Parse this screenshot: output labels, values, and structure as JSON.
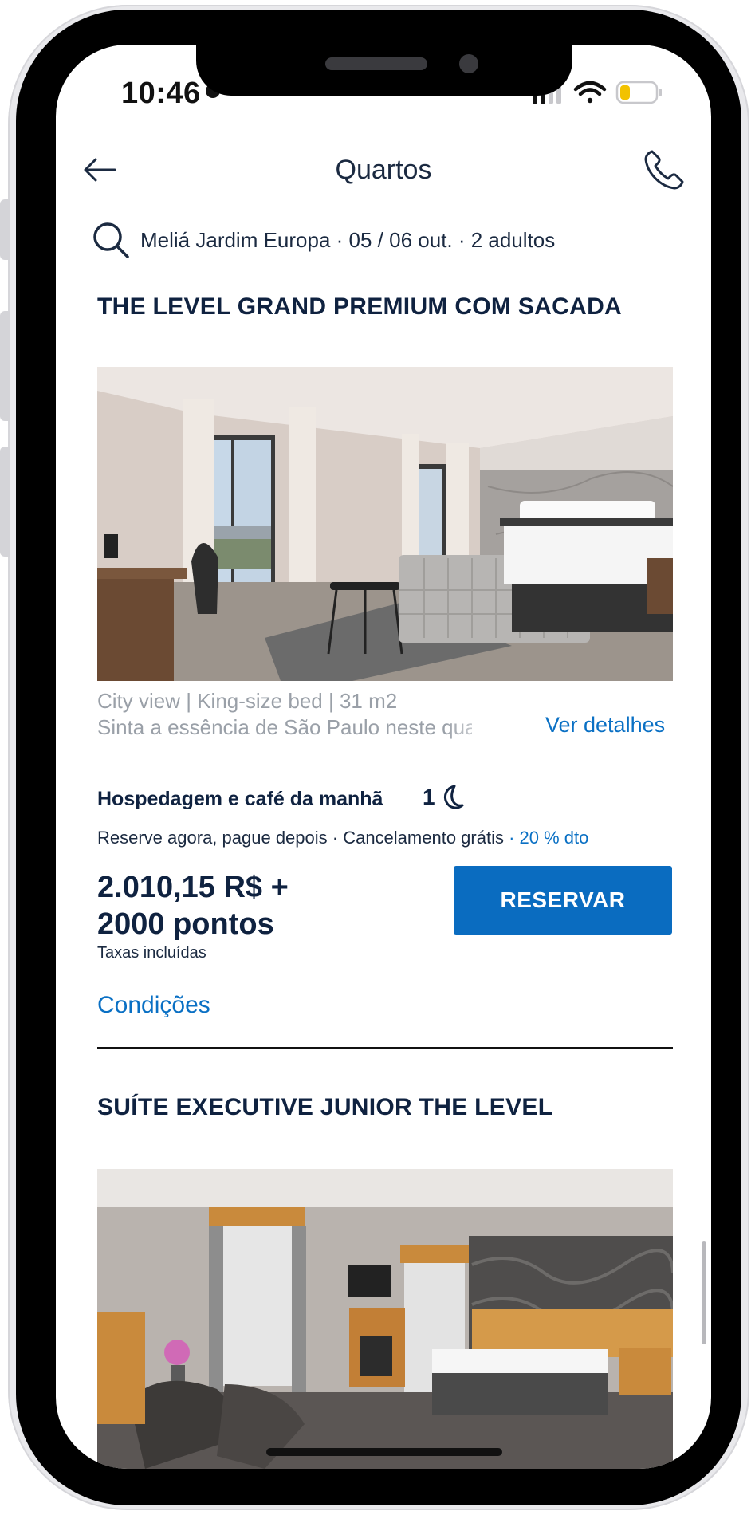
{
  "status_bar": {
    "time": "10:46"
  },
  "header": {
    "title": "Quartos",
    "back_icon": "arrow-left-icon",
    "phone_icon": "phone-icon"
  },
  "search": {
    "summary": "Meliá Jardim Europa · 05 / 06 out. · 2 adultos",
    "icon": "search-icon"
  },
  "rooms": [
    {
      "title": "THE LEVEL GRAND PREMIUM COM SACADA",
      "features": "City view | King-size bed | 31 m2",
      "description": "Sinta a essência de São Paulo neste quarto",
      "details_link": "Ver detalhes",
      "rate": {
        "plan": "Hospedagem e café da manhã",
        "nights": "1",
        "conditions": "Reserve agora, pague depois · Cancelamento grátis",
        "discount": "· 20 % dto",
        "price": "2.010,15 R$ + 2000 pontos",
        "price_line1": "2.010,15 R$ +",
        "price_line2": "2000 pontos",
        "taxes": "Taxas incluídas",
        "reserve_button": "RESERVAR",
        "conditions_link": "Condições"
      }
    },
    {
      "title": "SUÍTE EXECUTIVE JUNIOR THE LEVEL"
    }
  ],
  "colors": {
    "accent": "#0a6cc0",
    "link": "#0a70c4",
    "title": "#0f2240",
    "muted": "#9aa0a8"
  }
}
